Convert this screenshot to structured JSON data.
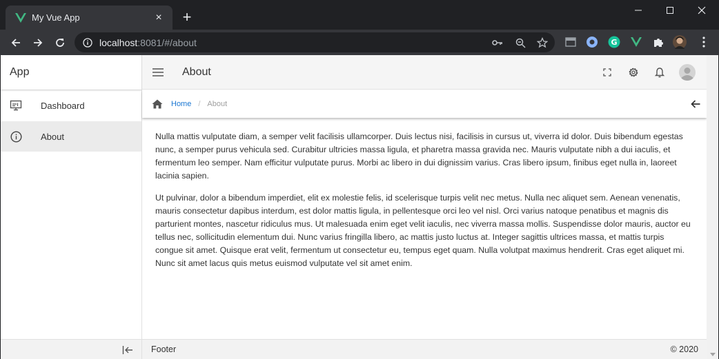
{
  "browser": {
    "tab_title": "My Vue App",
    "tab_close": "×",
    "new_tab": "+",
    "url_host": "localhost",
    "url_rest": ":8081/#/about",
    "icons": [
      "back-arrow-icon",
      "forward-arrow-icon",
      "reload-icon",
      "info-icon",
      "key-icon",
      "zoom-icon",
      "star-icon",
      "extension-icons",
      "profile-avatar",
      "kebab-menu-icon"
    ]
  },
  "sidebar": {
    "title": "App",
    "items": [
      {
        "label": "Dashboard",
        "icon": "monitor-icon",
        "active": false
      },
      {
        "label": "About",
        "icon": "info-circle-icon",
        "active": true
      }
    ]
  },
  "appbar": {
    "title": "About",
    "icons": [
      "fullscreen-icon",
      "settings-icon",
      "bell-icon",
      "avatar"
    ]
  },
  "breadcrumb": {
    "home": "Home",
    "separator": "/",
    "current": "About"
  },
  "content": {
    "paragraphs": [
      "Nulla mattis vulputate diam, a semper velit facilisis ullamcorper. Duis lectus nisi, facilisis in cursus ut, viverra id dolor. Duis bibendum egestas nunc, a semper purus vehicula sed. Curabitur ultricies massa ligula, et pharetra massa gravida nec. Mauris vulputate nibh a dui iaculis, et fermentum leo semper. Nam efficitur vulputate purus. Morbi ac libero in dui dignissim varius. Cras libero ipsum, finibus eget nulla in, laoreet lacinia sapien.",
      "Ut pulvinar, dolor a bibendum imperdiet, elit ex molestie felis, id scelerisque turpis velit nec metus. Nulla nec aliquet sem. Aenean venenatis, mauris consectetur dapibus interdum, est dolor mattis ligula, in pellentesque orci leo vel nisl. Orci varius natoque penatibus et magnis dis parturient montes, nascetur ridiculus mus. Ut malesuada enim eget velit iaculis, nec viverra massa mollis. Suspendisse dolor mauris, auctor eu tellus nec, sollicitudin elementum dui. Nunc varius fringilla libero, ac mattis justo luctus at. Integer sagittis ultrices massa, et mattis turpis congue sit amet. Quisque erat velit, fermentum ut consectetur eu, tempus eget quam. Nulla volutpat maximus hendrerit. Cras eget aliquet mi. Nunc sit amet lacus quis metus euismod vulputate vel sit amet enim."
    ]
  },
  "footer": {
    "left": "Footer",
    "right": "© 2020"
  },
  "colors": {
    "vue_green": "#41b883",
    "link_blue": "#1976d2",
    "active_bg": "#ebebeb",
    "chrome_dark": "#202124",
    "chrome_toolbar": "#35363a"
  }
}
